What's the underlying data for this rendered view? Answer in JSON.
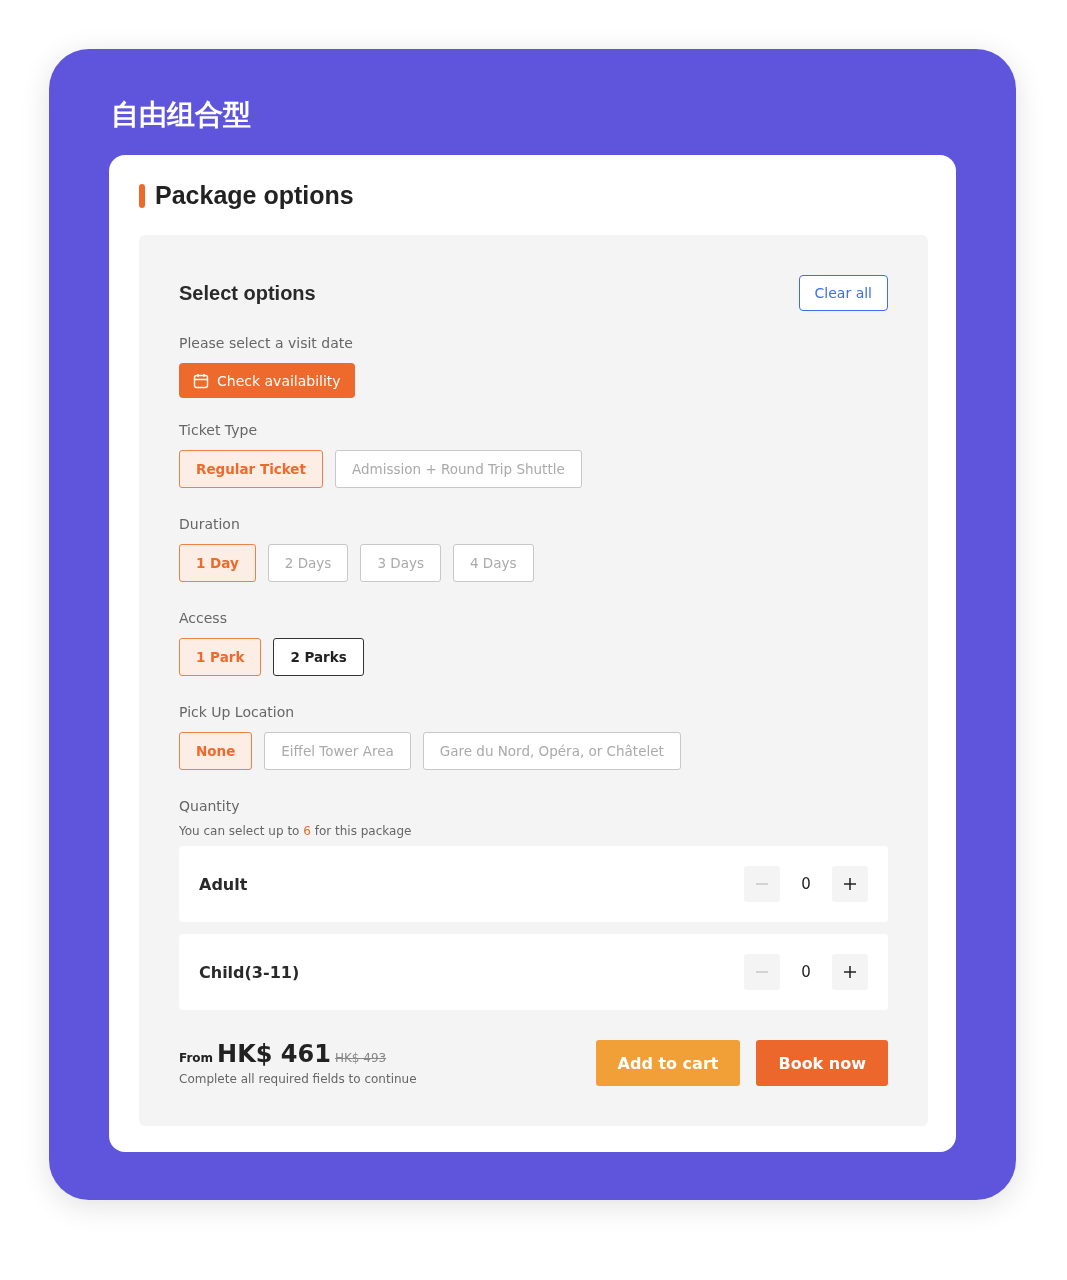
{
  "page_title": "自由组合型",
  "section_title": "Package options",
  "panel": {
    "title": "Select options",
    "clear_button": "Clear all",
    "date_label": "Please select a visit date",
    "date_button": "Check availability",
    "groups": [
      {
        "label": "Ticket Type",
        "options": [
          {
            "label": "Regular Ticket",
            "selected": true,
            "disabled": false
          },
          {
            "label": "Admission + Round Trip Shuttle",
            "selected": false,
            "disabled": true
          }
        ]
      },
      {
        "label": "Duration",
        "options": [
          {
            "label": "1 Day",
            "selected": true,
            "disabled": false
          },
          {
            "label": "2 Days",
            "selected": false,
            "disabled": true
          },
          {
            "label": "3 Days",
            "selected": false,
            "disabled": true
          },
          {
            "label": "4 Days",
            "selected": false,
            "disabled": true
          }
        ]
      },
      {
        "label": "Access",
        "options": [
          {
            "label": "1 Park",
            "selected": true,
            "disabled": false
          },
          {
            "label": "2 Parks",
            "selected": false,
            "disabled": false
          }
        ]
      },
      {
        "label": "Pick Up Location",
        "options": [
          {
            "label": "None",
            "selected": true,
            "disabled": false
          },
          {
            "label": "Eiffel Tower Area",
            "selected": false,
            "disabled": true
          },
          {
            "label": "Gare du Nord, Opéra, or Châtelet",
            "selected": false,
            "disabled": true
          }
        ]
      }
    ],
    "quantity_label": "Quantity",
    "limit_note": {
      "before": "You can select up to ",
      "count": "6",
      "after": " for this package"
    },
    "quantities": [
      {
        "label": "Adult",
        "value": "0",
        "decrease_disabled": true
      },
      {
        "label": "Child(3-11)",
        "value": "0",
        "decrease_disabled": true
      }
    ],
    "price": {
      "prefix": "From",
      "amount": "HK$ 461",
      "original": "HK$ 493",
      "note": "Complete all required fields to continue"
    },
    "buttons": [
      {
        "label": "Add to cart",
        "kind": "secondary"
      },
      {
        "label": "Book now",
        "kind": "primary"
      }
    ]
  }
}
